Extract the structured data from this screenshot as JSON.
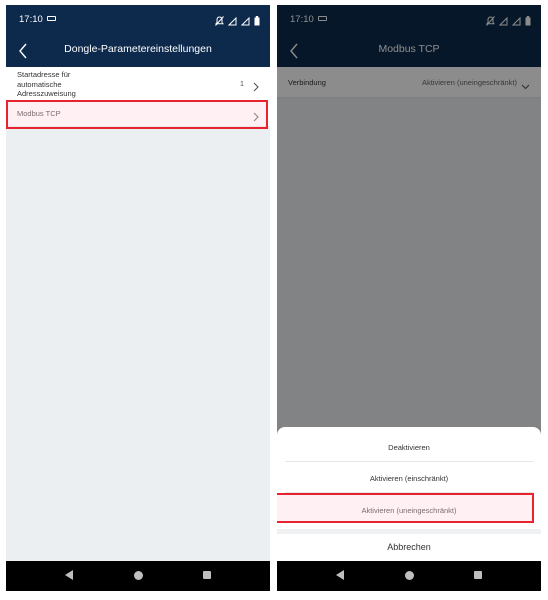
{
  "status_bar": {
    "time": "17:10"
  },
  "left_screen": {
    "title": "Dongle-Parametereinstellungen",
    "items": [
      {
        "label": "Startadresse für\nautomatische\nAdresszuweisung",
        "value": "1"
      },
      {
        "label": "Modbus TCP",
        "value": ""
      }
    ]
  },
  "right_screen": {
    "title": "Modbus TCP",
    "setting": {
      "label": "Verbindung",
      "value": "Aktivieren (uneingeschränkt)"
    },
    "sheet": {
      "options": [
        "Deaktivieren",
        "Aktivieren (einschränkt)",
        "Aktivieren (uneingeschränkt)"
      ],
      "cancel": "Abbrechen"
    }
  },
  "colors": {
    "header": "#0d2a4d",
    "highlight": "#e6232f",
    "background": "#eceff2"
  }
}
